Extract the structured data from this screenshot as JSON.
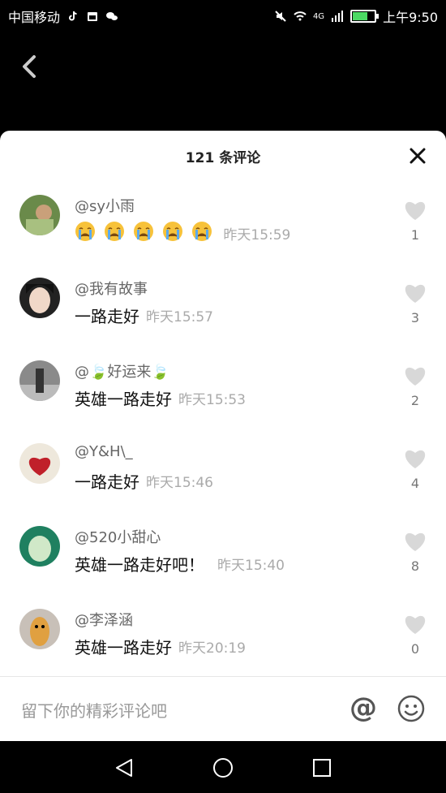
{
  "status_bar": {
    "carrier": "中国移动",
    "network": "4G",
    "time": "上午9:50"
  },
  "header": {
    "title": "121 条评论"
  },
  "comments": [
    {
      "user": "@sy小雨",
      "text": "",
      "time": "昨天15:59",
      "likes": "1",
      "emoji_count": 5
    },
    {
      "user": "@我有故事",
      "text": "一路走好",
      "time": "昨天15:57",
      "likes": "3"
    },
    {
      "user": "@🍃好运来🍃",
      "text": "英雄一路走好",
      "time": "昨天15:53",
      "likes": "2"
    },
    {
      "user": "@Y&H\\_",
      "text": "一路走好",
      "time": "昨天15:46",
      "likes": "4"
    },
    {
      "user": "@520小甜心",
      "text": "英雄一路走好吧！",
      "time": "昨天15:40",
      "likes": "8"
    },
    {
      "user": "@李泽涵",
      "text": "英雄一路走好",
      "time": "昨天20:19",
      "likes": "0"
    }
  ],
  "input": {
    "placeholder": "留下你的精彩评论吧",
    "at_symbol": "@"
  },
  "icons": {
    "back": "back-arrow-icon",
    "close": "close-icon",
    "like": "heart-icon",
    "emoji": "smiley-icon",
    "nav_back": "triangle-back-icon",
    "nav_home": "circle-home-icon",
    "nav_recent": "square-recent-icon"
  },
  "colors": {
    "heart": "#d8d8d8",
    "time": "#aaaaaa"
  }
}
